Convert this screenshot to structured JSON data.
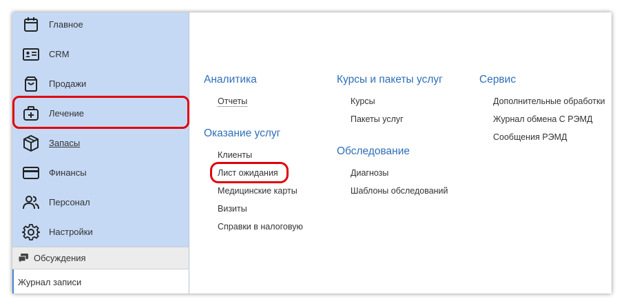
{
  "sidebar": {
    "items": [
      {
        "label": "Главное",
        "icon": "calendar-icon"
      },
      {
        "label": "CRM",
        "icon": "contact-card-icon"
      },
      {
        "label": "Продажи",
        "icon": "shopping-bag-icon"
      },
      {
        "label": "Лечение",
        "icon": "medical-bag-icon"
      },
      {
        "label": "Запасы",
        "icon": "box-icon"
      },
      {
        "label": "Финансы",
        "icon": "credit-card-icon"
      },
      {
        "label": "Персонал",
        "icon": "people-icon"
      },
      {
        "label": "Настройки",
        "icon": "gear-icon"
      }
    ],
    "discussions_label": "Обсуждения",
    "journal_label": "Журнал записи"
  },
  "content": {
    "groups": {
      "analytics": {
        "title": "Аналитика",
        "items": [
          "Отчеты"
        ]
      },
      "services": {
        "title": "Оказание услуг",
        "items": [
          "Клиенты",
          "Лист ожидания",
          "Медицинские карты",
          "Визиты",
          "Справки в налоговую"
        ]
      },
      "courses": {
        "title": "Курсы и пакеты услуг",
        "items": [
          "Курсы",
          "Пакеты услуг"
        ]
      },
      "exam": {
        "title": "Обследование",
        "items": [
          "Диагнозы",
          "Шаблоны обследований"
        ]
      },
      "service": {
        "title": "Сервис",
        "items": [
          "Дополнительные обработки",
          "Журнал обмена С РЭМД",
          "Сообщения РЭМД"
        ]
      }
    }
  },
  "colors": {
    "sidebar_bg": "#c5d9f4",
    "group_title": "#2f6fb8",
    "highlight": "#e0000b"
  }
}
